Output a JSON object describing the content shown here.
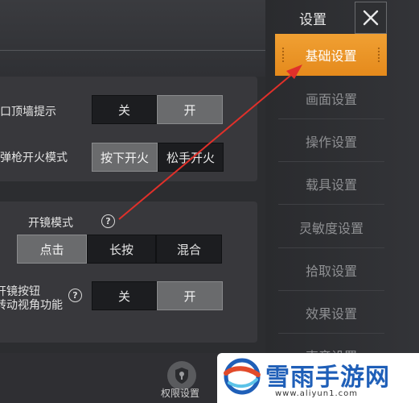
{
  "header": {
    "title": "设置",
    "close_label": "✕"
  },
  "sidebar": {
    "items": [
      {
        "label": "基础设置",
        "active": true
      },
      {
        "label": "画面设置",
        "active": false
      },
      {
        "label": "操作设置",
        "active": false
      },
      {
        "label": "载具设置",
        "active": false
      },
      {
        "label": "灵敏度设置",
        "active": false
      },
      {
        "label": "拾取设置",
        "active": false
      },
      {
        "label": "效果设置",
        "active": false
      },
      {
        "label": "声音设置",
        "active": false
      }
    ]
  },
  "settings": {
    "wall_hint": {
      "label": "枪口顶墙提示",
      "options": [
        "关",
        "开"
      ],
      "selected": "开"
    },
    "fire_mode": {
      "label": "狙弹枪开火模式",
      "options": [
        "按下开火",
        "松手开火"
      ],
      "selected": "按下开火"
    },
    "scope_mode": {
      "label": "开镜模式",
      "help": "?",
      "options": [
        "点击",
        "长按",
        "混合"
      ],
      "selected": "点击"
    },
    "scope_button": {
      "label_line1": "开镜按钮",
      "label_line2": "转动视角功能",
      "help": "?",
      "options": [
        "关",
        "开"
      ],
      "selected": "开"
    }
  },
  "bottom": {
    "permission_label": "权限设置"
  },
  "watermark": {
    "text": "雪雨手游网",
    "url": "www.aliyun1.com"
  },
  "colors": {
    "accent": "#ed9629",
    "arrow": "#e0302a",
    "watermark_blue": "#1f5fb8"
  }
}
